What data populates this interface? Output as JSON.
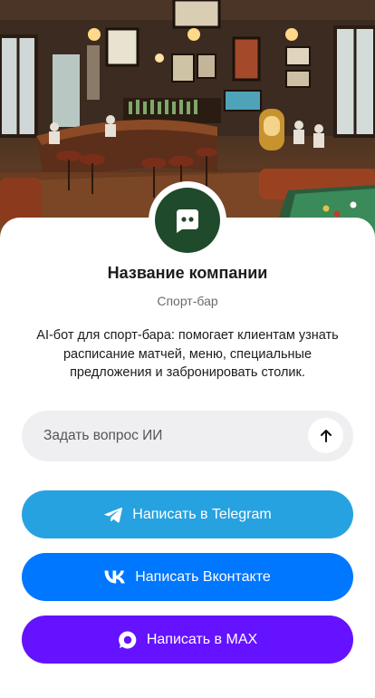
{
  "company": {
    "name": "Название компании",
    "type": "Спорт-бар",
    "description": "AI-бот для спорт-бара: помогает клиентам узнать расписание матчей, меню, специальные предложения и забронировать столик."
  },
  "ask": {
    "placeholder": "Задать вопрос ИИ",
    "send_icon": "arrow-up-icon"
  },
  "buttons": {
    "telegram": {
      "label": "Написать в Telegram",
      "icon": "telegram-icon",
      "color": "#27a2e0"
    },
    "vk": {
      "label": "Написать Вконтакте",
      "icon": "vk-icon",
      "color": "#0077ff"
    },
    "max": {
      "label": "Написать в MAX",
      "icon": "max-icon",
      "color": "#6412ff"
    }
  },
  "colors": {
    "avatar_bg": "#1f4a2b",
    "input_bg": "#efeff1"
  }
}
